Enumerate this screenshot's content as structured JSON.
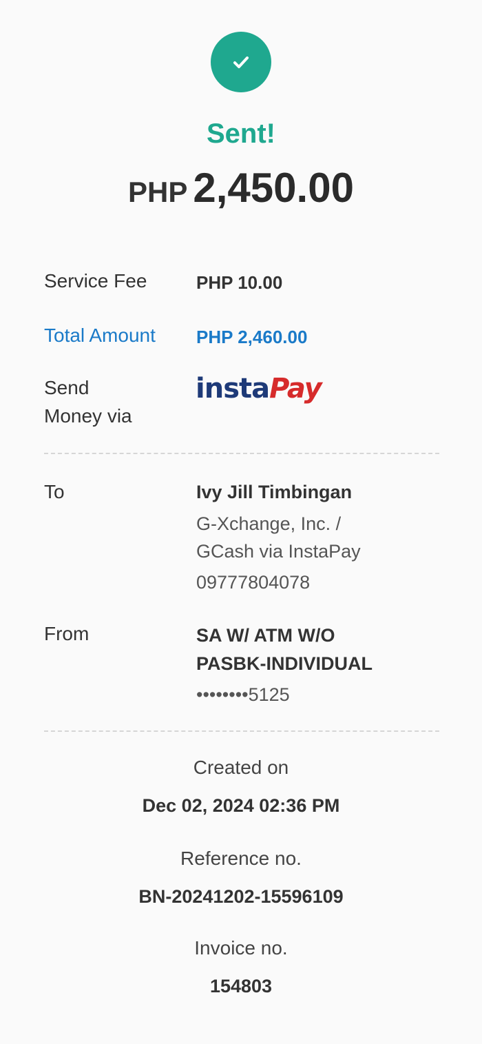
{
  "status": {
    "icon": "check-icon",
    "title": "Sent!",
    "currency": "PHP",
    "amount": "2,450.00",
    "accent_color": "#1fa88f"
  },
  "details": {
    "service_fee_label": "Service Fee",
    "service_fee_value": "PHP 10.00",
    "total_label": "Total Amount",
    "total_value": "PHP 2,460.00",
    "total_color": "#1a7ac8",
    "send_via_label_line1": "Send",
    "send_via_label_line2": "Money via",
    "send_via_logo": {
      "insta": "insta",
      "pay": "Pay",
      "insta_color": "#1e3a78",
      "pay_color": "#d62b2b"
    }
  },
  "to": {
    "label": "To",
    "name": "Ivy Jill Timbingan",
    "bank_line1": "G-Xchange, Inc. /",
    "bank_line2": "GCash via InstaPay",
    "account": "09777804078"
  },
  "from": {
    "label": "From",
    "account_type_line1": "SA W/ ATM W/O",
    "account_type_line2": "PASBK-INDIVIDUAL",
    "account_masked": "••••••••5125"
  },
  "meta": {
    "created_label": "Created on",
    "created_value": "Dec 02, 2024 02:36 PM",
    "reference_label": "Reference no.",
    "reference_value": "BN-20241202-15596109",
    "invoice_label": "Invoice no.",
    "invoice_value": "154803"
  }
}
